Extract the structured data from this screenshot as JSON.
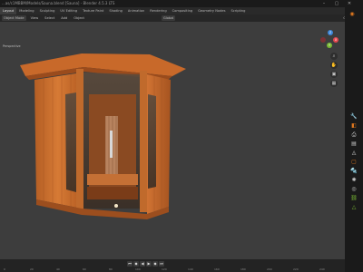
{
  "window": {
    "title": "...as/c1MBBM/Models/Sauna.blend [Sauna] - Blender 4.5.3 LTS",
    "controls": [
      "–",
      "▢",
      "✕"
    ]
  },
  "tabs": [
    "Layout",
    "Modeling",
    "Sculpting",
    "UV Editing",
    "Texture Paint",
    "Shading",
    "Animation",
    "Rendering",
    "Compositing",
    "Geometry Nodes",
    "Scripting"
  ],
  "active_tab": "Layout",
  "header": {
    "mode": "Object Mode",
    "menus": [
      "View",
      "Select",
      "Add",
      "Object"
    ],
    "transform": "Global",
    "options_label": "Options"
  },
  "subheader": {
    "label": "Perspective",
    "collection": "(1) Collection | Sauna"
  },
  "timeline": {
    "frame_labels": [
      "0",
      "20",
      "40",
      "60",
      "80",
      "100",
      "120",
      "140",
      "160",
      "180",
      "200",
      "220",
      "240"
    ]
  },
  "colors": {
    "accent": "#e0781f",
    "viewport_bg": "#3d3d3d",
    "gizmo_x": "#e3474e",
    "gizmo_y": "#7ab935",
    "gizmo_z": "#3d86d8"
  }
}
